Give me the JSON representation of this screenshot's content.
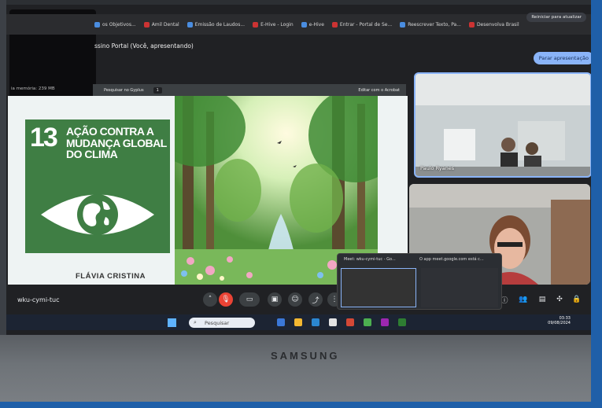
{
  "browser": {
    "bookmarks": [
      "os Objetivos...",
      "Amil Dental",
      "Emissão de Laudos...",
      "E-Hive - Login",
      "e-Hive",
      "Entrar - Portal de Se...",
      "Reescrever Texto, Pa...",
      "Desenvolva Brasil"
    ],
    "update_button": "Reiniciar para atualizar"
  },
  "meet": {
    "presentation_title": "ssino Portal (Você, apresentando)",
    "stop_presenting": "Parar apresentação",
    "meeting_code": "wku-cymi-tuc",
    "memory_label": "ia memória: 239 MB",
    "participant1_name": "Paulo Ryanes"
  },
  "pdf": {
    "toolbar_label": "Pesquisar no Gyplus",
    "page": "1",
    "edit_label": "Editar com o Acrobat"
  },
  "slide": {
    "sdg_number": "13",
    "sdg_title": "AÇÃO CONTRA A MUDANÇA GLOBAL DO CLIMA",
    "author": "FLÁVIA CRISTINA"
  },
  "preview": {
    "title1": "Meet: wku-cymi-tuc - Go...",
    "title2": "O app meet.google.com está c..."
  },
  "taskbar": {
    "search_placeholder": "Pesquisar",
    "time": "03:33",
    "date": "09/08/2024"
  },
  "laptop": {
    "brand": "SAMSUNG"
  },
  "colors": {
    "sdg_green": "#3f7e44",
    "meet_blue": "#8ab4f8",
    "photo_frame": "#1f5fa8"
  }
}
